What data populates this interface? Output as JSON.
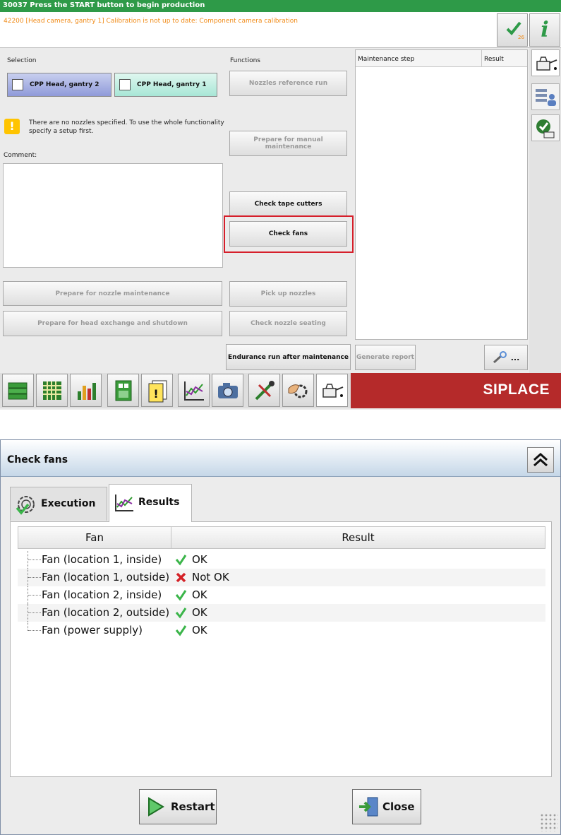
{
  "status_bar": {
    "text": "30037 Press the START button to begin production"
  },
  "message": {
    "text": "42200 [Head camera, gantry 1] Calibration is not up to date: Component camera calibration",
    "ack_count": "26"
  },
  "selection": {
    "label": "Selection",
    "options": [
      {
        "label": "CPP Head, gantry 2",
        "selected": true
      },
      {
        "label": "CPP Head, gantry 1",
        "selected": false
      }
    ]
  },
  "warning": {
    "text": "There are no nozzles specified. To use the whole functionality specify a setup first."
  },
  "comment": {
    "label": "Comment:",
    "value": ""
  },
  "functions": {
    "label": "Functions",
    "nozzles_reference_run": "Nozzles reference run",
    "prepare_manual_maintenance": "Prepare for manual maintenance",
    "check_tape_cutters": "Check tape cutters",
    "check_fans": "Check fans",
    "pick_up_nozzles": "Pick up nozzles",
    "check_nozzle_seating": "Check nozzle seating",
    "endurance_run": "Endurance run after maintenance",
    "prepare_nozzle_maintenance": "Prepare for nozzle maintenance",
    "prepare_head_exchange": "Prepare for head exchange and shutdown"
  },
  "maintenance_table": {
    "col_step": "Maintenance step",
    "col_result": "Result"
  },
  "generate_report": "Generate report",
  "more_button": "...",
  "brand": "SIPLACE",
  "dialog": {
    "title": "Check fans",
    "tabs": [
      {
        "label": "Execution",
        "active": false
      },
      {
        "label": "Results",
        "active": true
      }
    ],
    "columns": {
      "fan": "Fan",
      "result": "Result"
    },
    "rows": [
      {
        "fan": "Fan (location 1, inside)",
        "result": "OK",
        "status": "ok"
      },
      {
        "fan": "Fan (location 1, outside)",
        "result": "Not OK",
        "status": "fail"
      },
      {
        "fan": "Fan (location 2, inside)",
        "result": "OK",
        "status": "ok"
      },
      {
        "fan": "Fan (location 2, outside)",
        "result": "OK",
        "status": "ok"
      },
      {
        "fan": "Fan (power supply)",
        "result": "OK",
        "status": "ok"
      }
    ],
    "restart_label": "Restart",
    "close_label": "Close"
  },
  "colors": {
    "status_bar": "#2e9a48",
    "message_text": "#f08a16",
    "brand_bg": "#b52a2a",
    "highlight": "#d61f2b",
    "ok": "#3bb54a",
    "fail": "#d42026"
  },
  "icons": {
    "taskbar": [
      "money-stack-icon",
      "feeder-grid-icon",
      "bar-chart-icon",
      "board-layout-icon",
      "document-warning-icon",
      "line-chart-icon",
      "camera-icon",
      "tools-icon",
      "hand-gear-icon",
      "oil-can-icon"
    ],
    "sidebar": [
      "oil-can-icon",
      "list-person-icon",
      "checkmark-oil-icon"
    ]
  }
}
